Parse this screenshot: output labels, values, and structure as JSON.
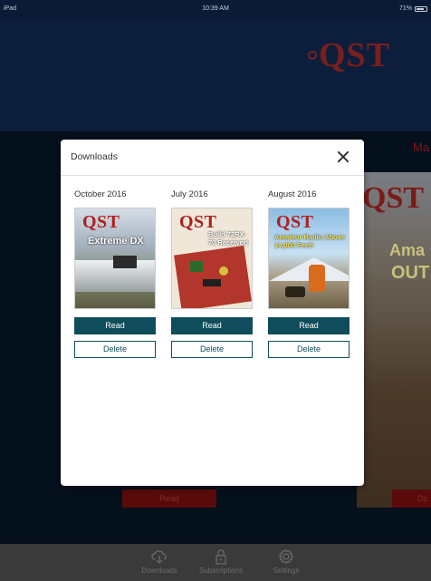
{
  "status_bar": {
    "carrier": "iPad",
    "time": "10:39 AM",
    "battery": "71%"
  },
  "header": {
    "logo_text": "QST"
  },
  "background": {
    "magazine_label": "Ma",
    "read_label": "Read",
    "read_label_2": "Do",
    "cover_title": "QST",
    "cover_line1": "Ama",
    "cover_line2": "OUT"
  },
  "modal": {
    "title": "Downloads",
    "issues": [
      {
        "date": "October 2016",
        "cover_logo": "QST",
        "headline": "Extreme DX",
        "read": "Read",
        "delete": "Delete"
      },
      {
        "date": "July 2016",
        "cover_logo": "QST",
        "headline": "Build 72RX-70 Receiver!",
        "read": "Read",
        "delete": "Delete"
      },
      {
        "date": "August 2016",
        "cover_logo": "QST",
        "headline": "Amateur Radio Above 14,000 Feet!",
        "read": "Read",
        "delete": "Delete"
      }
    ]
  },
  "tabbar": {
    "tabs": [
      {
        "label": "Downloads",
        "icon": "cloud-download-icon"
      },
      {
        "label": "Subscriptions",
        "icon": "lock-icon"
      },
      {
        "label": "Settings",
        "icon": "gear-icon"
      }
    ]
  },
  "colors": {
    "primary_button": "#0f4c5c",
    "background_navy": "#0c1e3b",
    "accent_red": "#7a1f1d"
  }
}
